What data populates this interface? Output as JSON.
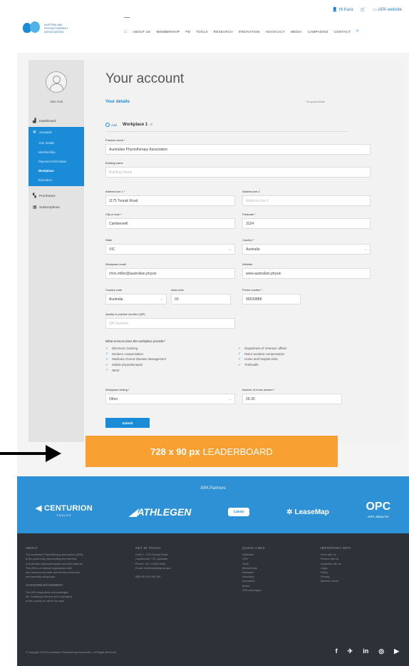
{
  "header": {
    "toplinks": {
      "login": "Hi Kara",
      "cart": "",
      "apa": "APA website"
    },
    "logo_text": "AUSTRALIAN PHYSIOTHERAPY ASSOCIATION",
    "nav": [
      "ABOUT US",
      "MEMBERSHIP",
      "PD",
      "TOOLS",
      "RESEARCH",
      "INNOVATION",
      "ADVOCACY",
      "MEDIA",
      "CAMPAIGNS",
      "CONTACT"
    ]
  },
  "sidebar": {
    "username": "Alan Hok",
    "dashboard": "Dashboard",
    "account": "Account",
    "sub": [
      "Your details",
      "Membership",
      "Payment information",
      "Workplace",
      "Education"
    ],
    "purchases": "Purchases",
    "subscriptions": "Subscriptions"
  },
  "page": {
    "title": "Your account",
    "subtitle": "Your details",
    "required_note": "* Required fields",
    "tab_add": "Add",
    "tab_workplace": "Workplace 1"
  },
  "form": {
    "practice_name": {
      "label": "Practice name *",
      "value": "Australian Physiotherapy Association"
    },
    "building_name": {
      "label": "Building name",
      "placeholder": "Building Name"
    },
    "address1": {
      "label": "Address line 1 *",
      "value": "1175 Toorak Road"
    },
    "address2": {
      "label": "Address line 2",
      "placeholder": "Address line 2"
    },
    "city": {
      "label": "City or town *",
      "value": "Camberwell"
    },
    "postcode": {
      "label": "Postcode *",
      "value": "3124"
    },
    "state": {
      "label": "State",
      "value": "VIC"
    },
    "country": {
      "label": "Country *",
      "value": "Australia"
    },
    "email": {
      "label": "Workplace email",
      "value": "chris.miller@australian.physio"
    },
    "website": {
      "label": "Website",
      "value": "www.australian.physio"
    },
    "country_code": {
      "label": "Country code",
      "value": "Australia"
    },
    "area_code": {
      "label": "Area code",
      "value": "03"
    },
    "phone": {
      "label": "Phone number *",
      "value": "90920888"
    },
    "quality": {
      "label": "Quality in practice number (QIP)",
      "placeholder": "QIP Number"
    },
    "services_q": "What services does this workplace provide?",
    "services_left": [
      "Electronic claiming",
      "Workers compensation",
      "Medicare chronic Disease Management",
      "Mobile physiotherapist",
      "NDIS"
    ],
    "services_right": [
      "Department of Veterans' affairs",
      "Motor accident compensation",
      "Home and hospital visits",
      "Telehealth"
    ],
    "setting": {
      "label": "Workplace setting *",
      "value": "Other"
    },
    "hours": {
      "label": "Number of hours worked *",
      "value": "26-30"
    },
    "submit": "Submit"
  },
  "leaderboard": {
    "size": "728 x 90 px",
    "label": "LEADERBOARD",
    "color": "#f8a032"
  },
  "partners": {
    "title": "APA Partners",
    "logos": [
      "CENTURION",
      "TABLES",
      "ATHLEGEN",
      "Lasso",
      "LeaseMap",
      "OPC",
      "OPC HEALTH"
    ]
  },
  "footer": {
    "about_h": "ABOUT",
    "about": [
      "The Australian Physiotherapy Association (APA)",
      "is the peak body representing the interests",
      "of Australian physiotherapists and their patients.",
      "The APA is a national organisation with",
      "non-autonomous state and territory branches",
      "and specialty subgroups."
    ],
    "ack_h": "ACKNOWLEDGEMENT",
    "ack": [
      "The APA respectfully acknowledges",
      "the Traditional Owners and Custodians",
      "of the country on which we work."
    ],
    "touch_h": "GET IN TOUCH",
    "touch": [
      "Level 1, 1175 Toorak Road",
      "Camberwell, VIC, Australia",
      "Phone: +61 3 9092 0888",
      "Email: info@australian.physio"
    ],
    "abn": "ABN 89 004 265 150",
    "quick_h": "QUICK LINKS",
    "quick": [
      "Advertise",
      "CPD",
      "Tools",
      "Membership",
      "Research",
      "Advocacy",
      "Innovation",
      "Media",
      "APA campaigns"
    ],
    "important_h": "IMPORTANT INFO",
    "important": [
      "Work with us",
      "Partner with us",
      "Advertise with us",
      "Legal",
      "Policy",
      "Privacy",
      "Member Home"
    ],
    "copyright": "© Copyright 2019 by Australian Physiotherapy Association - All Rights Reserved",
    "social": [
      "f",
      "t",
      "in",
      "ig",
      "yt"
    ]
  }
}
